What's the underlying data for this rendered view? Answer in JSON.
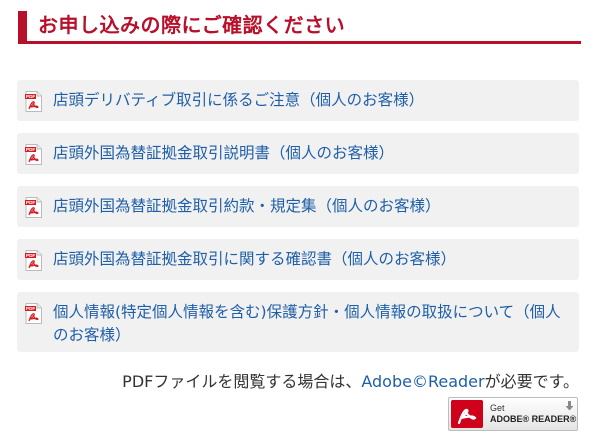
{
  "header": {
    "title": "お申し込みの際にご確認ください",
    "accent_color": "#b8102a"
  },
  "documents": [
    {
      "icon": "pdf-icon",
      "label": "店頭デリバティブ取引に係るご注意（個人のお客様）"
    },
    {
      "icon": "pdf-icon",
      "label": "店頭外国為替証拠金取引説明書（個人のお客様）"
    },
    {
      "icon": "pdf-icon",
      "label": "店頭外国為替証拠金取引約款・規定集（個人のお客様）"
    },
    {
      "icon": "pdf-icon",
      "label": "店頭外国為替証拠金取引に関する確認書（個人のお客様）"
    },
    {
      "icon": "pdf-icon",
      "label": "個人情報(特定個人情報を含む)保護方針・個人情報の取扱について（個人のお客様）"
    }
  ],
  "note": {
    "prefix": "PDFファイルを閲覧する場合は、",
    "link": "Adobe©Reader",
    "suffix": "が必要です。",
    "link_color": "#1f5fa8"
  },
  "adobe_badge": {
    "get": "Get",
    "product": "ADOBE® READER®",
    "icon": "adobe-logo-icon"
  }
}
